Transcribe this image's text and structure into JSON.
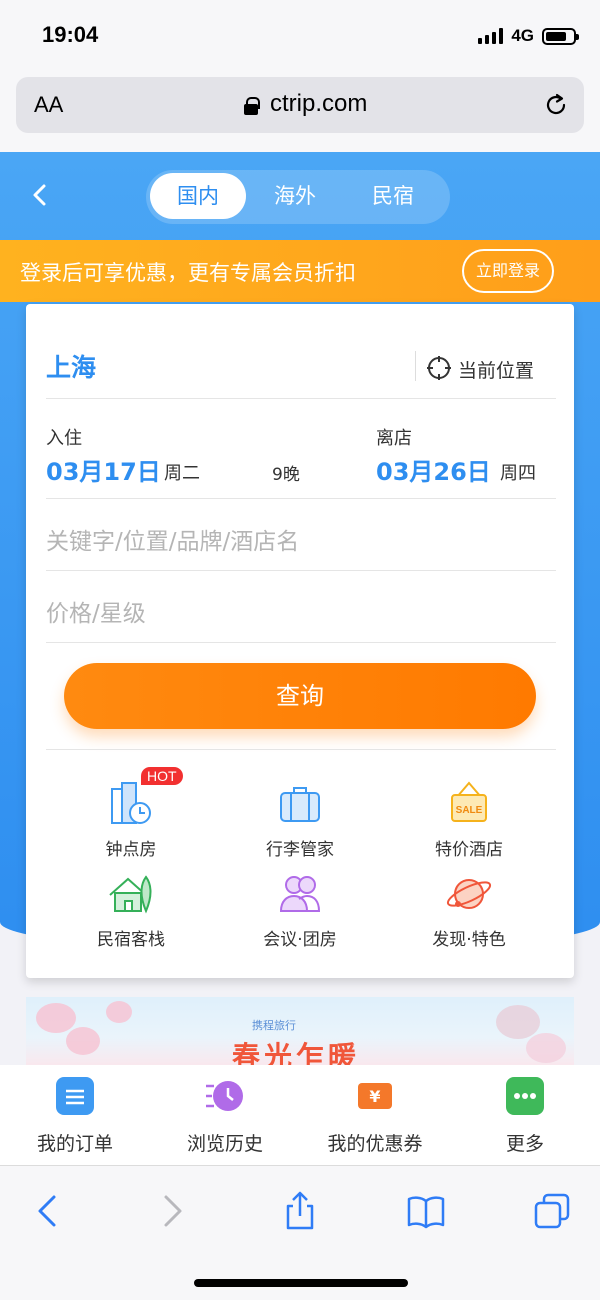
{
  "status_bar": {
    "time": "19:04",
    "network": "4G"
  },
  "browser": {
    "text_size_label": "AA",
    "url": "ctrip.com"
  },
  "header": {
    "tabs": [
      {
        "label": "国内",
        "active": true
      },
      {
        "label": "海外",
        "active": false
      },
      {
        "label": "民宿",
        "active": false
      }
    ]
  },
  "promo": {
    "text": "登录后可享优惠，更有专属会员折扣",
    "button": "立即登录"
  },
  "search": {
    "city": "上海",
    "current_location": "当前位置",
    "checkin_label": "入住",
    "checkin_date": "03月17日",
    "checkin_weekday": "周二",
    "nights": "9晚",
    "checkout_label": "离店",
    "checkout_date": "03月26日",
    "checkout_weekday": "周四",
    "keyword_placeholder": "关键字/位置/品牌/酒店名",
    "price_placeholder": "价格/星级",
    "search_button": "查询"
  },
  "features": [
    {
      "label": "钟点房",
      "icon": "hourly-room-icon",
      "badge": "HOT"
    },
    {
      "label": "行李管家",
      "icon": "luggage-icon"
    },
    {
      "label": "特价酒店",
      "icon": "sale-tag-icon"
    },
    {
      "label": "民宿客栈",
      "icon": "homestay-house-icon"
    },
    {
      "label": "会议·团房",
      "icon": "group-people-icon"
    },
    {
      "label": "发现·特色",
      "icon": "planet-icon"
    }
  ],
  "ad_banner": {
    "title": "春光乍暖",
    "brand": "携程旅行"
  },
  "quick_nav": [
    {
      "label": "我的订单",
      "icon": "orders-icon",
      "color": "#3e9af2"
    },
    {
      "label": "浏览历史",
      "icon": "history-icon",
      "color": "#b06be8"
    },
    {
      "label": "我的优惠券",
      "icon": "coupon-icon",
      "color": "#f4782a"
    },
    {
      "label": "更多",
      "icon": "more-icon",
      "color": "#3fb95a"
    }
  ],
  "colors": {
    "primary_blue": "#2e8ef0",
    "orange": "#ff8a10",
    "promo_orange": "#ffb21f"
  }
}
